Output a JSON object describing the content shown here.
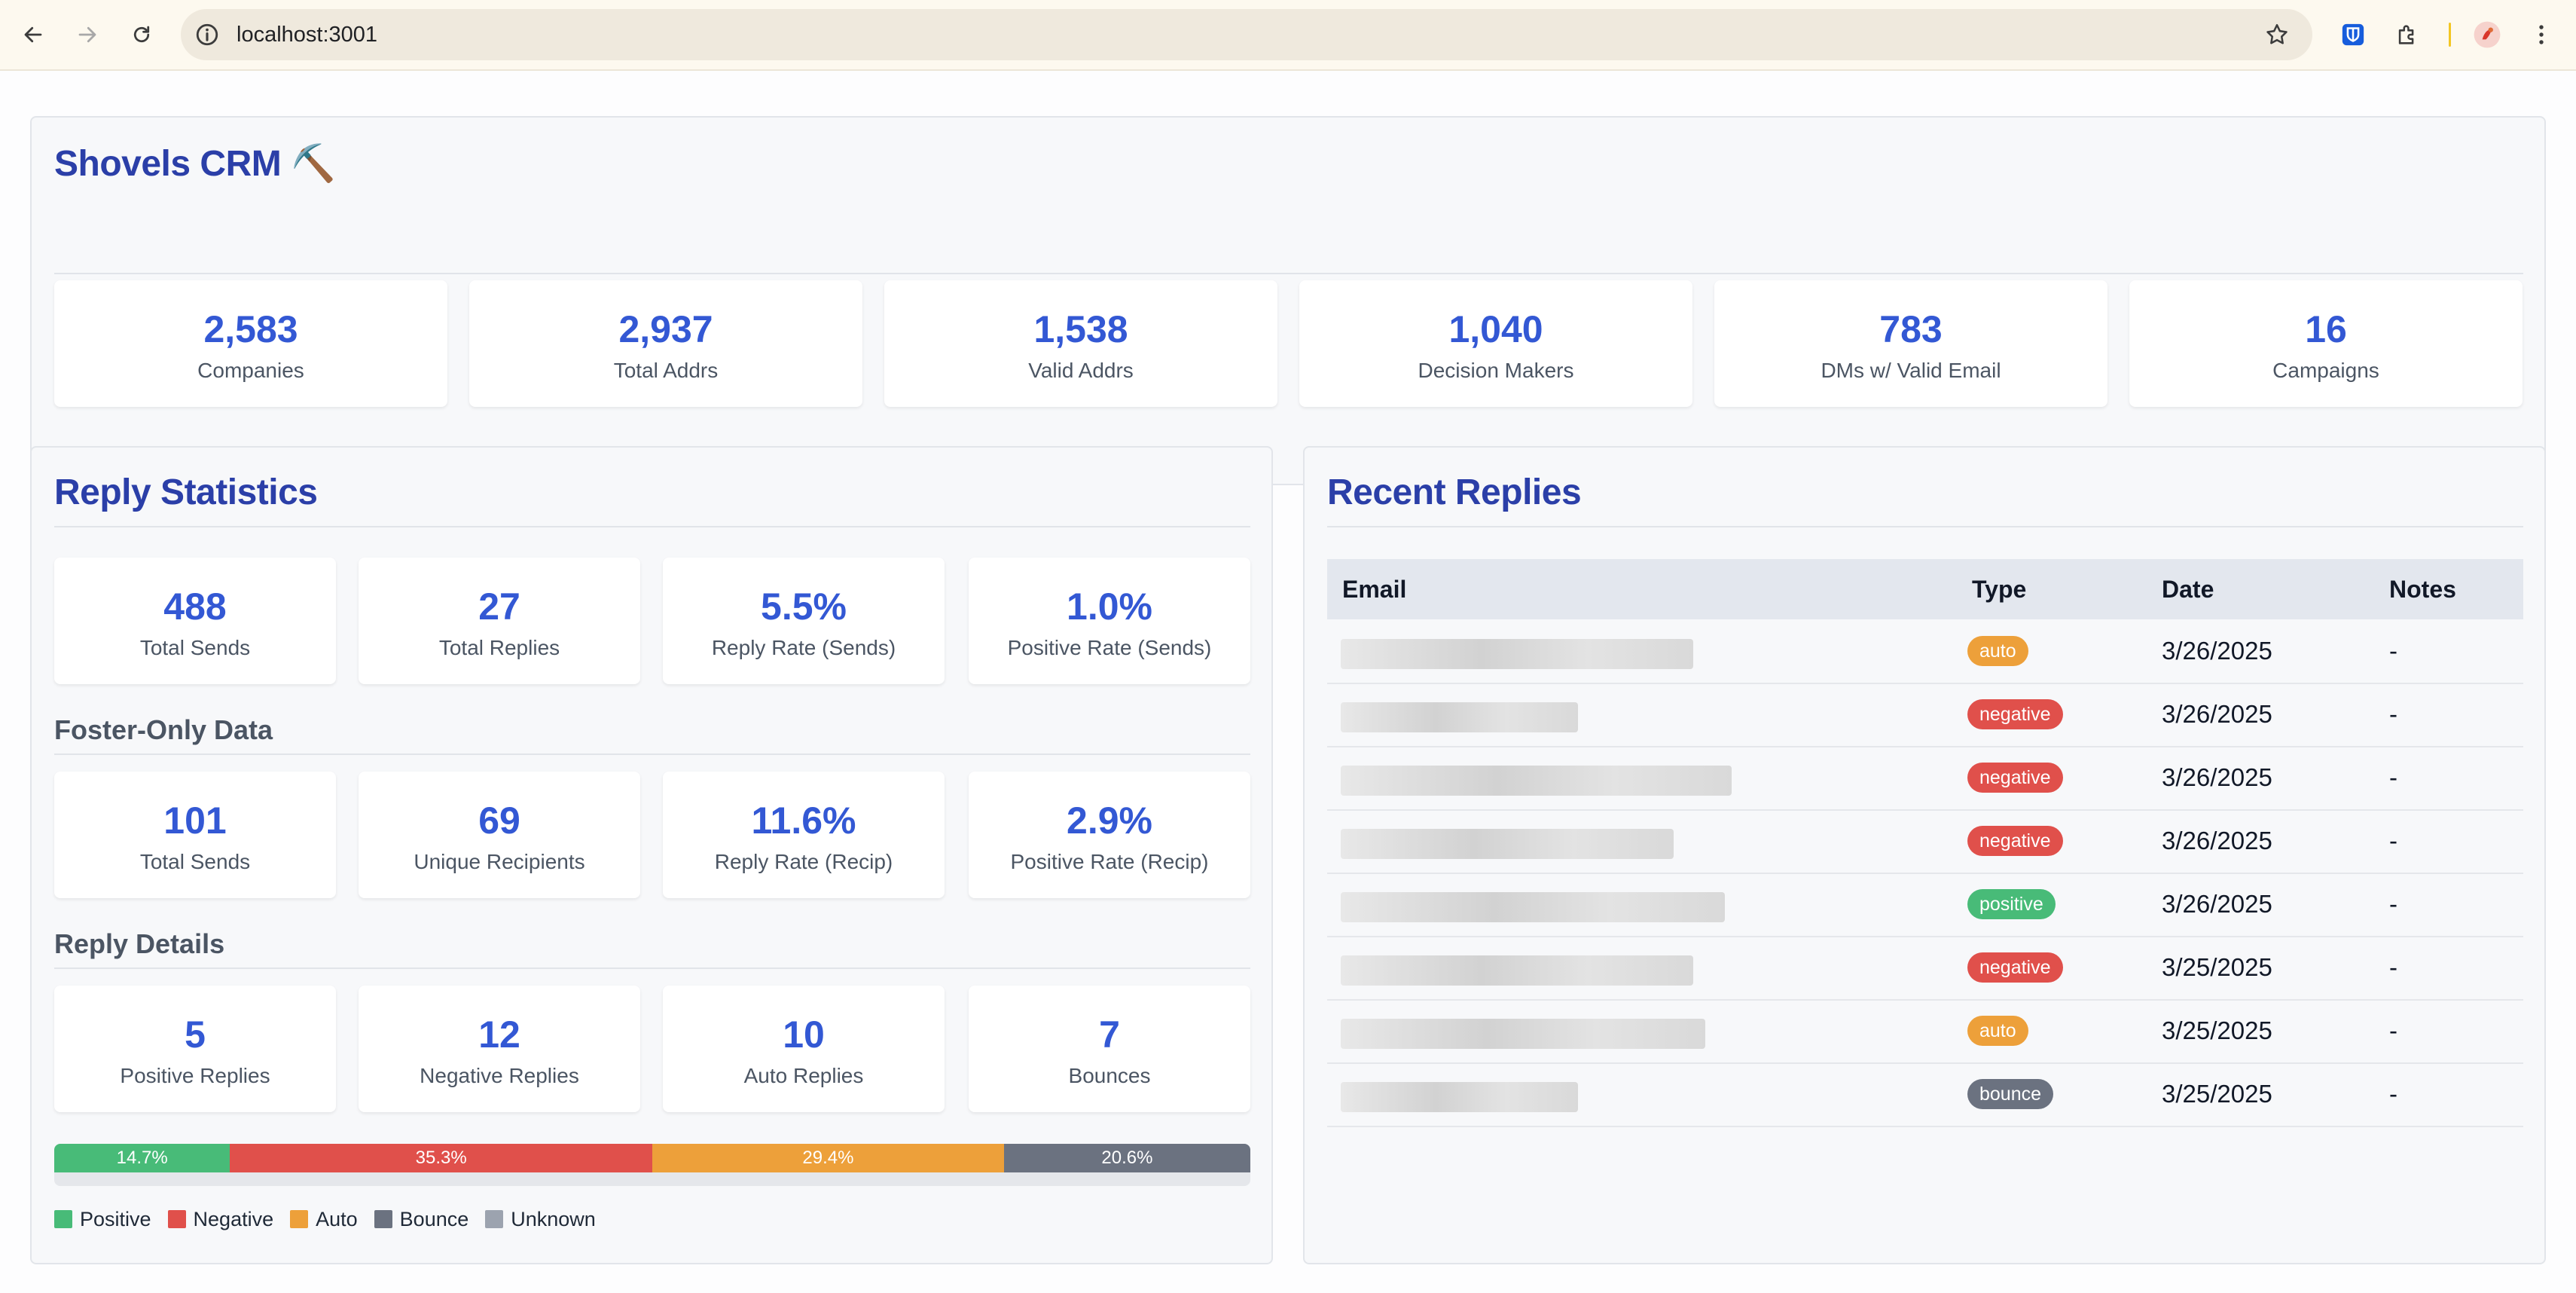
{
  "browser": {
    "url": "localhost:3001"
  },
  "crm": {
    "title": "Shovels CRM",
    "title_emoji": "⛏️",
    "stats": [
      {
        "value": "2,583",
        "label": "Companies"
      },
      {
        "value": "2,937",
        "label": "Total Addrs"
      },
      {
        "value": "1,538",
        "label": "Valid Addrs"
      },
      {
        "value": "1,040",
        "label": "Decision Makers"
      },
      {
        "value": "783",
        "label": "DMs w/ Valid Email"
      },
      {
        "value": "16",
        "label": "Campaigns"
      }
    ]
  },
  "reply_stats": {
    "title": "Reply Statistics",
    "stats": [
      {
        "value": "488",
        "label": "Total Sends"
      },
      {
        "value": "27",
        "label": "Total Replies"
      },
      {
        "value": "5.5%",
        "label": "Reply Rate (Sends)"
      },
      {
        "value": "1.0%",
        "label": "Positive Rate (Sends)"
      }
    ],
    "foster_title": "Foster-Only Data",
    "foster_stats": [
      {
        "value": "101",
        "label": "Total Sends"
      },
      {
        "value": "69",
        "label": "Unique Recipients"
      },
      {
        "value": "11.6%",
        "label": "Reply Rate (Recip)"
      },
      {
        "value": "2.9%",
        "label": "Positive Rate (Recip)"
      }
    ],
    "details_title": "Reply Details",
    "details_stats": [
      {
        "value": "5",
        "label": "Positive Replies"
      },
      {
        "value": "12",
        "label": "Negative Replies"
      },
      {
        "value": "10",
        "label": "Auto Replies"
      },
      {
        "value": "7",
        "label": "Bounces"
      }
    ],
    "distribution": [
      {
        "key": "positive",
        "label": "14.7%",
        "percent": 14.7,
        "color": "#48bb78"
      },
      {
        "key": "negative",
        "label": "35.3%",
        "percent": 35.3,
        "color": "#e0504b"
      },
      {
        "key": "auto",
        "label": "29.4%",
        "percent": 29.4,
        "color": "#eda03a"
      },
      {
        "key": "bounce",
        "label": "20.6%",
        "percent": 20.6,
        "color": "#6b7280"
      }
    ],
    "legend": [
      {
        "label": "Positive",
        "color": "#48bb78"
      },
      {
        "label": "Negative",
        "color": "#e0504b"
      },
      {
        "label": "Auto",
        "color": "#eda03a"
      },
      {
        "label": "Bounce",
        "color": "#6b7280"
      },
      {
        "label": "Unknown",
        "color": "#9ca3af"
      }
    ]
  },
  "recent_replies": {
    "title": "Recent Replies",
    "columns": [
      "Email",
      "Type",
      "Date",
      "Notes"
    ],
    "rows": [
      {
        "email_redacted_fraction": 0.55,
        "type": "auto",
        "type_color": "#eda03a",
        "date": "3/26/2025",
        "notes": "-"
      },
      {
        "email_redacted_fraction": 0.37,
        "type": "negative",
        "type_color": "#e0504b",
        "date": "3/26/2025",
        "notes": "-"
      },
      {
        "email_redacted_fraction": 0.61,
        "type": "negative",
        "type_color": "#e0504b",
        "date": "3/26/2025",
        "notes": "-"
      },
      {
        "email_redacted_fraction": 0.52,
        "type": "negative",
        "type_color": "#e0504b",
        "date": "3/26/2025",
        "notes": "-"
      },
      {
        "email_redacted_fraction": 0.6,
        "type": "positive",
        "type_color": "#48bb78",
        "date": "3/26/2025",
        "notes": "-"
      },
      {
        "email_redacted_fraction": 0.55,
        "type": "negative",
        "type_color": "#e0504b",
        "date": "3/25/2025",
        "notes": "-"
      },
      {
        "email_redacted_fraction": 0.57,
        "type": "auto",
        "type_color": "#eda03a",
        "date": "3/25/2025",
        "notes": "-"
      },
      {
        "email_redacted_fraction": 0.37,
        "type": "bounce",
        "type_color": "#6b7280",
        "date": "3/25/2025",
        "notes": "-"
      }
    ]
  },
  "colors": {
    "accent": "#3358d4",
    "heading": "#2b3fa8"
  }
}
